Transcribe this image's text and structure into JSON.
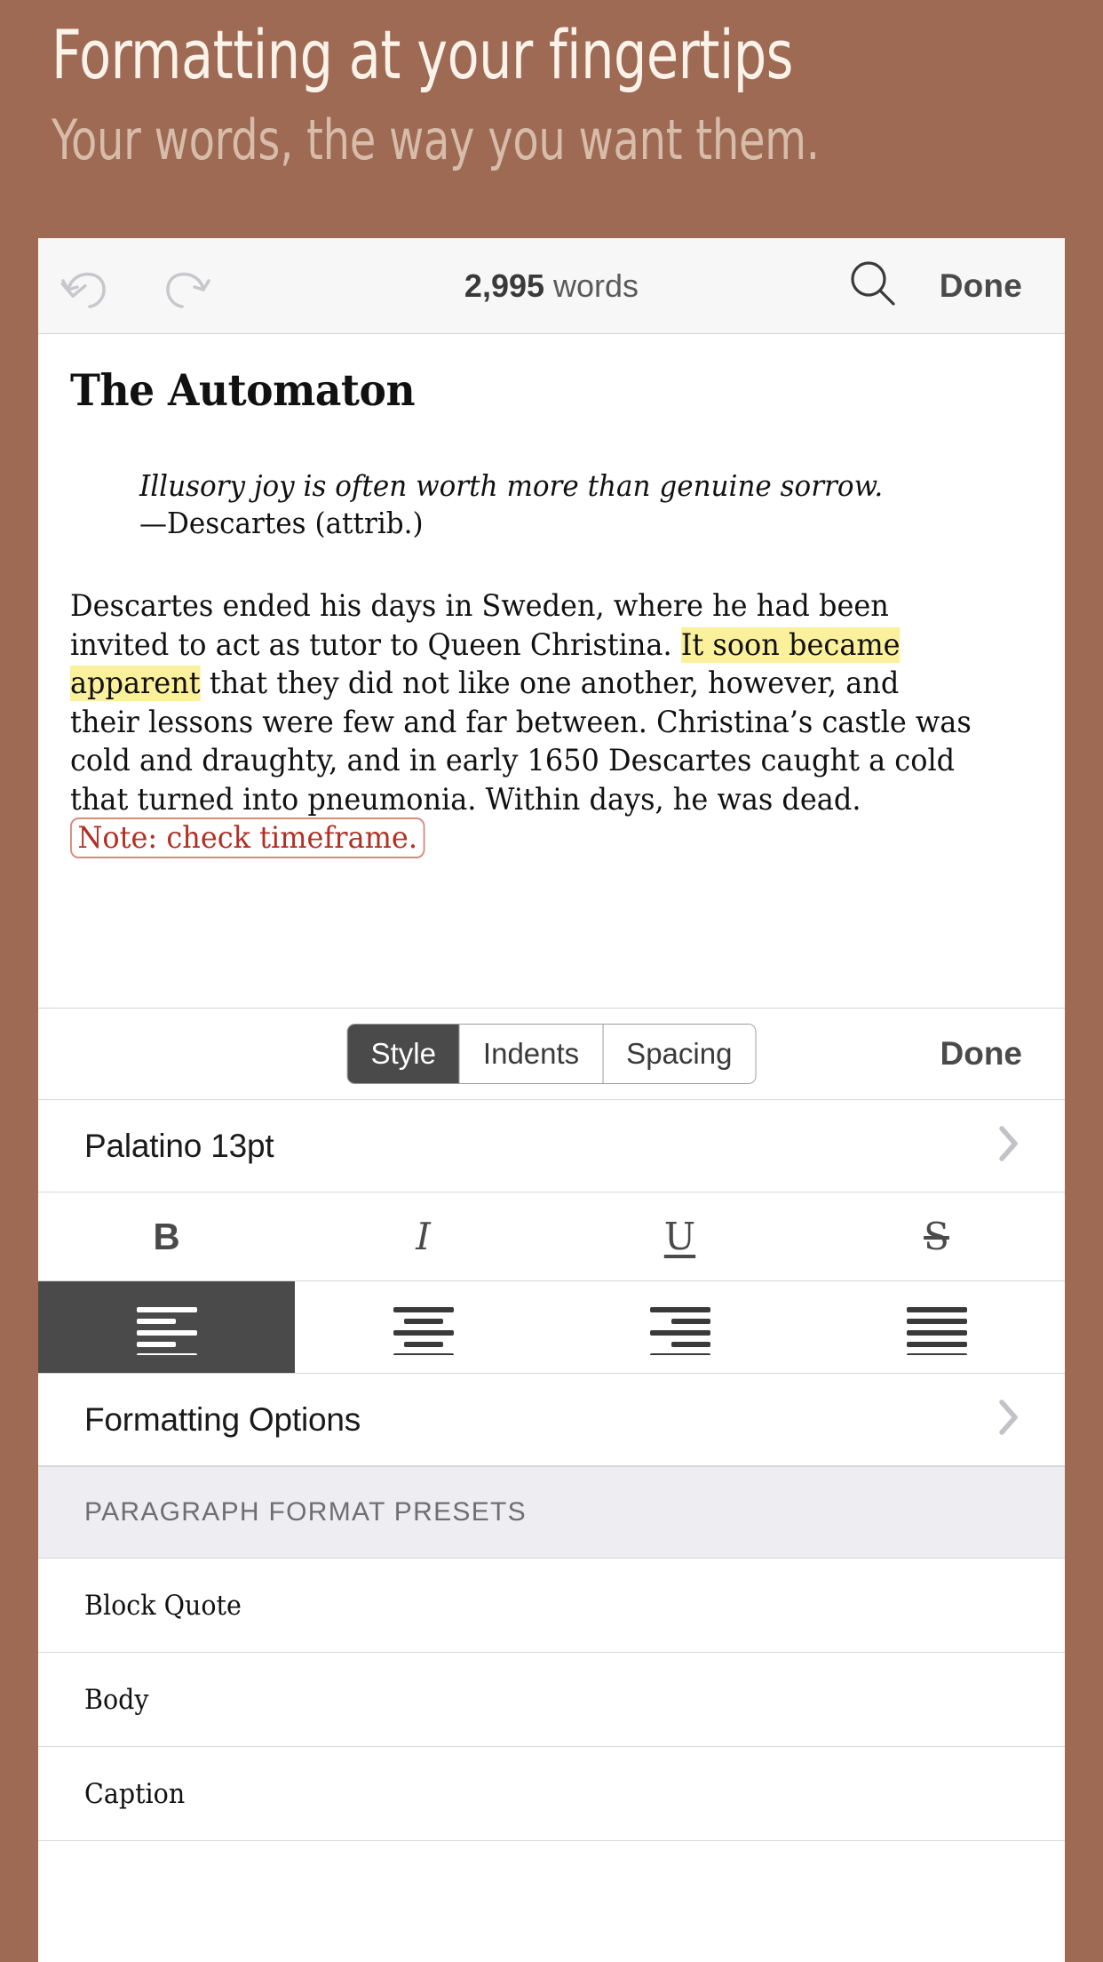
{
  "promo": {
    "title": "Formatting at your fingertips",
    "subtitle": "Your words, the way you want them."
  },
  "colors": {
    "background": "#9E6A54",
    "promo_title": "#FBF3EA",
    "promo_subtitle": "#D6BCA9",
    "toolbar_bg": "#F7F7F7",
    "selected_segment": "#4A4A4A",
    "highlight_yellow": "#FBF09B",
    "annotation_red": "#B03024",
    "annotation_border": "#D98A7E",
    "section_header_bg": "#EEEEF2",
    "chevron_gray": "#C2C2C7"
  },
  "toolbar": {
    "undo_icon": "undo-icon",
    "redo_icon": "redo-icon",
    "word_count_number": "2,995",
    "word_count_label": "words",
    "search_icon": "search-icon",
    "done_label": "Done"
  },
  "document": {
    "title": "The Automaton",
    "quote_text": "Illusory joy is often worth more than genuine sorrow.",
    "quote_attribution": "—Descartes (attrib.)",
    "paragraph": {
      "part1": "Descartes ended his days in Sweden, where he had been invited to act as tutor to Queen Christina. ",
      "highlight": "It soon became apparent",
      "part2": " that they did not like one another, however, and their lessons were few and far between. Christina’s castle was cold and draughty, and in early 1650 Descartes caught a cold that turned into pneumonia. Within days, he was dead. ",
      "annotation": "Note: check timeframe."
    }
  },
  "format_bar": {
    "segments": [
      {
        "label": "Style",
        "selected": true
      },
      {
        "label": "Indents",
        "selected": false
      },
      {
        "label": "Spacing",
        "selected": false
      }
    ],
    "done_label": "Done"
  },
  "font_row": {
    "label": "Palatino 13pt",
    "chevron_icon": "chevron-right-icon"
  },
  "style_buttons": [
    {
      "label": "B",
      "name": "bold-button"
    },
    {
      "label": "I",
      "name": "italic-button"
    },
    {
      "label": "U",
      "name": "underline-button"
    },
    {
      "label": "S",
      "name": "strikethrough-button"
    }
  ],
  "alignment_buttons": [
    {
      "name": "align-left-button",
      "selected": true
    },
    {
      "name": "align-center-button",
      "selected": false
    },
    {
      "name": "align-right-button",
      "selected": false
    },
    {
      "name": "align-justify-button",
      "selected": false
    }
  ],
  "formatting_options_row": {
    "label": "Formatting Options",
    "chevron_icon": "chevron-right-icon"
  },
  "presets_section": {
    "header": "PARAGRAPH FORMAT PRESETS",
    "items": [
      {
        "label": "Block Quote"
      },
      {
        "label": "Body"
      },
      {
        "label": "Caption"
      }
    ]
  }
}
